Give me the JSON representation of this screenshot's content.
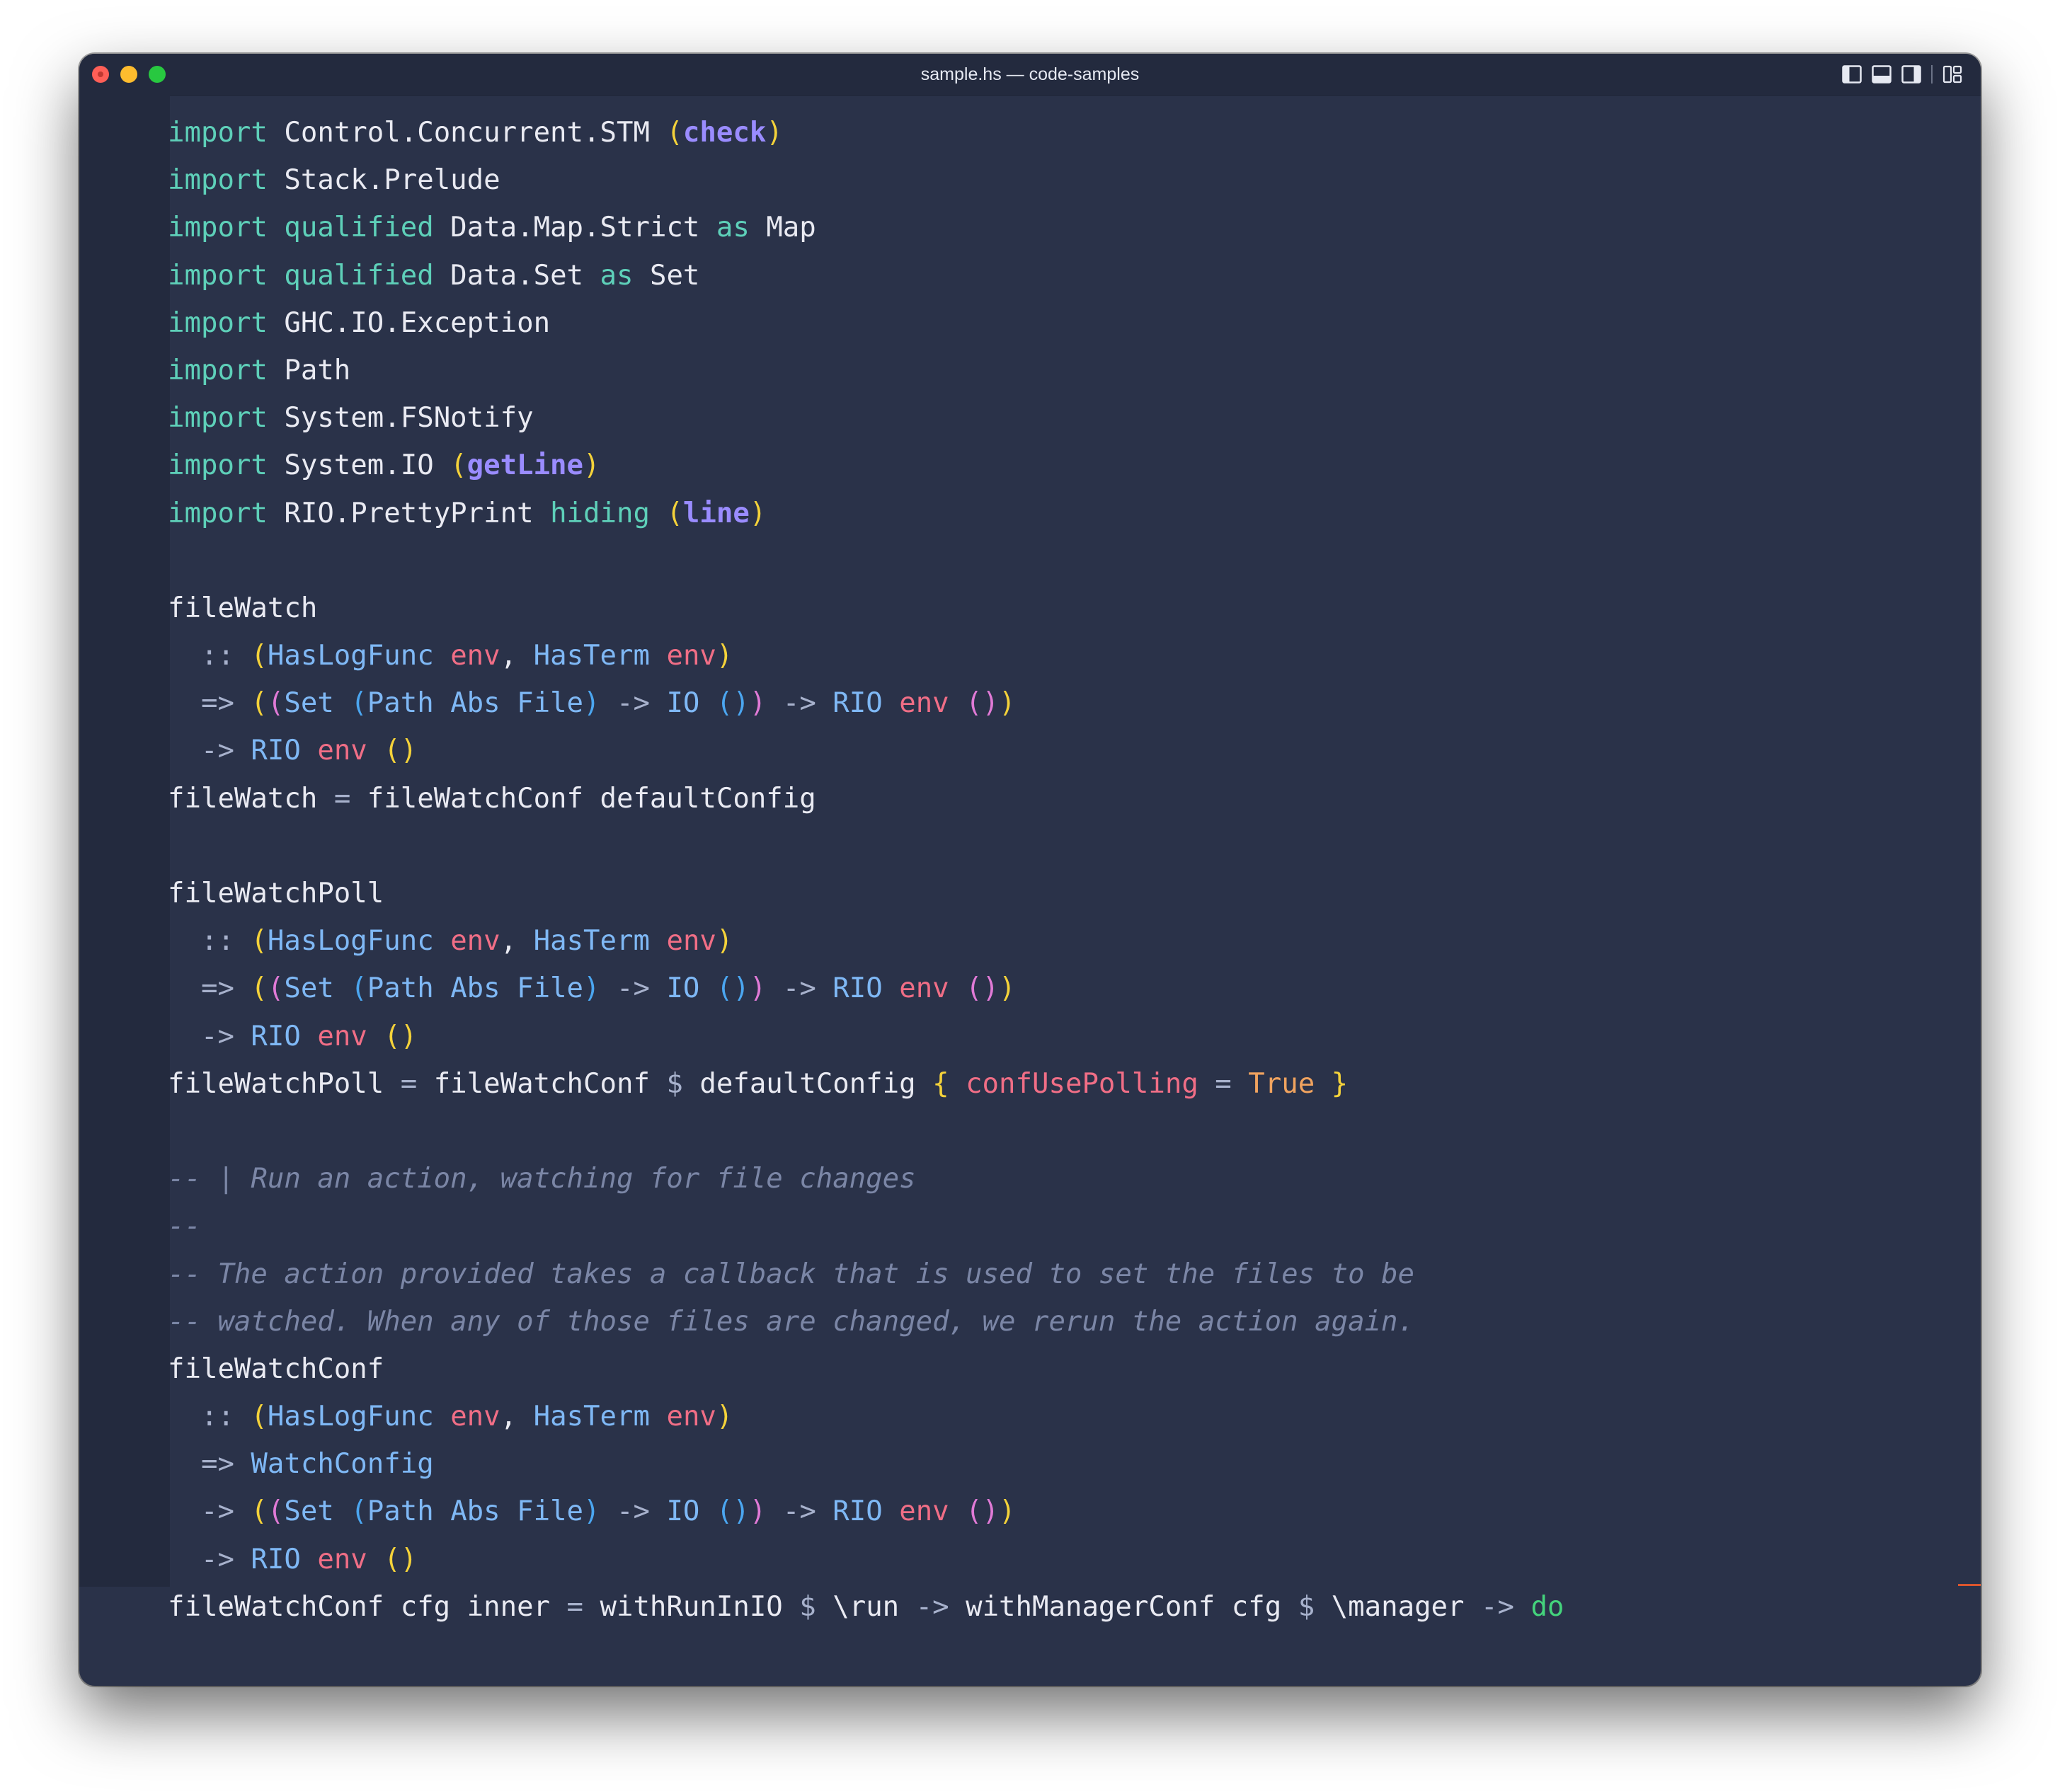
{
  "window": {
    "title": "sample.hs — code-samples",
    "background": "#2a3249",
    "titlebar_background": "#232a3e"
  },
  "titlebar": {
    "traffic_lights": [
      "close",
      "minimize",
      "zoom"
    ],
    "layout_icons": [
      "toggle-primary-sidebar-icon",
      "toggle-panel-icon",
      "toggle-secondary-sidebar-icon",
      "customize-layout-icon"
    ]
  },
  "editor": {
    "language": "haskell",
    "colors": {
      "keyword": "#5ed0b9",
      "comment": "#7b86a6",
      "type": "#7fb8f5",
      "variable": "#f06e86",
      "function": "#9a8cff",
      "constant": "#f0a35f",
      "bracket_1": "#f4d23a",
      "bracket_2": "#e07ad6",
      "bracket_3": "#4ba6f0"
    },
    "lines": [
      [
        [
          "kw",
          "import"
        ],
        [
          "plain",
          " Control.Concurrent.STM "
        ],
        [
          "p1",
          "("
        ],
        [
          "fn",
          "check"
        ],
        [
          "p1",
          ")"
        ]
      ],
      [
        [
          "kw",
          "import"
        ],
        [
          "plain",
          " Stack.Prelude"
        ]
      ],
      [
        [
          "kw",
          "import"
        ],
        [
          "plain",
          " "
        ],
        [
          "kw",
          "qualified"
        ],
        [
          "plain",
          " Data.Map.Strict "
        ],
        [
          "kw",
          "as"
        ],
        [
          "plain",
          " Map"
        ]
      ],
      [
        [
          "kw",
          "import"
        ],
        [
          "plain",
          " "
        ],
        [
          "kw",
          "qualified"
        ],
        [
          "plain",
          " Data.Set "
        ],
        [
          "kw",
          "as"
        ],
        [
          "plain",
          " Set"
        ]
      ],
      [
        [
          "kw",
          "import"
        ],
        [
          "plain",
          " GHC.IO.Exception"
        ]
      ],
      [
        [
          "kw",
          "import"
        ],
        [
          "plain",
          " Path"
        ]
      ],
      [
        [
          "kw",
          "import"
        ],
        [
          "plain",
          " System.FSNotify"
        ]
      ],
      [
        [
          "kw",
          "import"
        ],
        [
          "plain",
          " System.IO "
        ],
        [
          "p1",
          "("
        ],
        [
          "fn",
          "getLine"
        ],
        [
          "p1",
          ")"
        ]
      ],
      [
        [
          "kw",
          "import"
        ],
        [
          "plain",
          " RIO.PrettyPrint "
        ],
        [
          "kw",
          "hiding"
        ],
        [
          "plain",
          " "
        ],
        [
          "p1",
          "("
        ],
        [
          "fn",
          "line"
        ],
        [
          "p1",
          ")"
        ]
      ],
      [],
      [
        [
          "plain",
          "fileWatch"
        ]
      ],
      [
        [
          "op",
          "  :: "
        ],
        [
          "p1",
          "("
        ],
        [
          "ty",
          "HasLogFunc"
        ],
        [
          "plain",
          " "
        ],
        [
          "var",
          "env"
        ],
        [
          "plain",
          ", "
        ],
        [
          "ty",
          "HasTerm"
        ],
        [
          "plain",
          " "
        ],
        [
          "var",
          "env"
        ],
        [
          "p1",
          ")"
        ]
      ],
      [
        [
          "op",
          "  => "
        ],
        [
          "p1",
          "("
        ],
        [
          "p2",
          "("
        ],
        [
          "ty",
          "Set"
        ],
        [
          "plain",
          " "
        ],
        [
          "p3",
          "("
        ],
        [
          "ty",
          "Path Abs File"
        ],
        [
          "p3",
          ")"
        ],
        [
          "op",
          " -> "
        ],
        [
          "ty",
          "IO"
        ],
        [
          "plain",
          " "
        ],
        [
          "p3",
          "()"
        ],
        [
          "p2",
          ")"
        ],
        [
          "op",
          " -> "
        ],
        [
          "ty",
          "RIO"
        ],
        [
          "plain",
          " "
        ],
        [
          "var",
          "env"
        ],
        [
          "plain",
          " "
        ],
        [
          "p2",
          "()"
        ],
        [
          "p1",
          ")"
        ]
      ],
      [
        [
          "op",
          "  -> "
        ],
        [
          "ty",
          "RIO"
        ],
        [
          "plain",
          " "
        ],
        [
          "var",
          "env"
        ],
        [
          "plain",
          " "
        ],
        [
          "p1",
          "()"
        ]
      ],
      [
        [
          "plain",
          "fileWatch "
        ],
        [
          "op",
          "="
        ],
        [
          "plain",
          " fileWatchConf defaultConfig"
        ]
      ],
      [],
      [
        [
          "plain",
          "fileWatchPoll"
        ]
      ],
      [
        [
          "op",
          "  :: "
        ],
        [
          "p1",
          "("
        ],
        [
          "ty",
          "HasLogFunc"
        ],
        [
          "plain",
          " "
        ],
        [
          "var",
          "env"
        ],
        [
          "plain",
          ", "
        ],
        [
          "ty",
          "HasTerm"
        ],
        [
          "plain",
          " "
        ],
        [
          "var",
          "env"
        ],
        [
          "p1",
          ")"
        ]
      ],
      [
        [
          "op",
          "  => "
        ],
        [
          "p1",
          "("
        ],
        [
          "p2",
          "("
        ],
        [
          "ty",
          "Set"
        ],
        [
          "plain",
          " "
        ],
        [
          "p3",
          "("
        ],
        [
          "ty",
          "Path Abs File"
        ],
        [
          "p3",
          ")"
        ],
        [
          "op",
          " -> "
        ],
        [
          "ty",
          "IO"
        ],
        [
          "plain",
          " "
        ],
        [
          "p3",
          "()"
        ],
        [
          "p2",
          ")"
        ],
        [
          "op",
          " -> "
        ],
        [
          "ty",
          "RIO"
        ],
        [
          "plain",
          " "
        ],
        [
          "var",
          "env"
        ],
        [
          "plain",
          " "
        ],
        [
          "p2",
          "()"
        ],
        [
          "p1",
          ")"
        ]
      ],
      [
        [
          "op",
          "  -> "
        ],
        [
          "ty",
          "RIO"
        ],
        [
          "plain",
          " "
        ],
        [
          "var",
          "env"
        ],
        [
          "plain",
          " "
        ],
        [
          "p1",
          "()"
        ]
      ],
      [
        [
          "plain",
          "fileWatchPoll "
        ],
        [
          "op",
          "="
        ],
        [
          "plain",
          " fileWatchConf "
        ],
        [
          "op",
          "$"
        ],
        [
          "plain",
          " defaultConfig "
        ],
        [
          "p1",
          "{"
        ],
        [
          "plain",
          " "
        ],
        [
          "rec",
          "confUsePolling"
        ],
        [
          "plain",
          " "
        ],
        [
          "op",
          "="
        ],
        [
          "plain",
          " "
        ],
        [
          "con",
          "True"
        ],
        [
          "plain",
          " "
        ],
        [
          "p1",
          "}"
        ]
      ],
      [],
      [
        [
          "cmt",
          "-- | Run an action, watching for file changes"
        ]
      ],
      [
        [
          "cmt",
          "--"
        ]
      ],
      [
        [
          "cmt",
          "-- The action provided takes a callback that is used to set the files to be"
        ]
      ],
      [
        [
          "cmt",
          "-- watched. When any of those files are changed, we rerun the action again."
        ]
      ],
      [
        [
          "plain",
          "fileWatchConf"
        ]
      ],
      [
        [
          "op",
          "  :: "
        ],
        [
          "p1",
          "("
        ],
        [
          "ty",
          "HasLogFunc"
        ],
        [
          "plain",
          " "
        ],
        [
          "var",
          "env"
        ],
        [
          "plain",
          ", "
        ],
        [
          "ty",
          "HasTerm"
        ],
        [
          "plain",
          " "
        ],
        [
          "var",
          "env"
        ],
        [
          "p1",
          ")"
        ]
      ],
      [
        [
          "op",
          "  => "
        ],
        [
          "ty",
          "WatchConfig"
        ]
      ],
      [
        [
          "op",
          "  -> "
        ],
        [
          "p1",
          "("
        ],
        [
          "p2",
          "("
        ],
        [
          "ty",
          "Set"
        ],
        [
          "plain",
          " "
        ],
        [
          "p3",
          "("
        ],
        [
          "ty",
          "Path Abs File"
        ],
        [
          "p3",
          ")"
        ],
        [
          "op",
          " -> "
        ],
        [
          "ty",
          "IO"
        ],
        [
          "plain",
          " "
        ],
        [
          "p3",
          "()"
        ],
        [
          "p2",
          ")"
        ],
        [
          "op",
          " -> "
        ],
        [
          "ty",
          "RIO"
        ],
        [
          "plain",
          " "
        ],
        [
          "var",
          "env"
        ],
        [
          "plain",
          " "
        ],
        [
          "p2",
          "()"
        ],
        [
          "p1",
          ")"
        ]
      ],
      [
        [
          "op",
          "  -> "
        ],
        [
          "ty",
          "RIO"
        ],
        [
          "plain",
          " "
        ],
        [
          "var",
          "env"
        ],
        [
          "plain",
          " "
        ],
        [
          "p1",
          "()"
        ]
      ],
      [
        [
          "plain",
          "fileWatchConf cfg inner "
        ],
        [
          "op",
          "="
        ],
        [
          "plain",
          " withRunInIO "
        ],
        [
          "op",
          "$"
        ],
        [
          "plain",
          " \\run "
        ],
        [
          "op",
          "->"
        ],
        [
          "plain",
          " withManagerConf cfg "
        ],
        [
          "op",
          "$"
        ],
        [
          "plain",
          " \\manager "
        ],
        [
          "op",
          "->"
        ],
        [
          "plain",
          " "
        ],
        [
          "dokw",
          "do"
        ]
      ]
    ]
  }
}
